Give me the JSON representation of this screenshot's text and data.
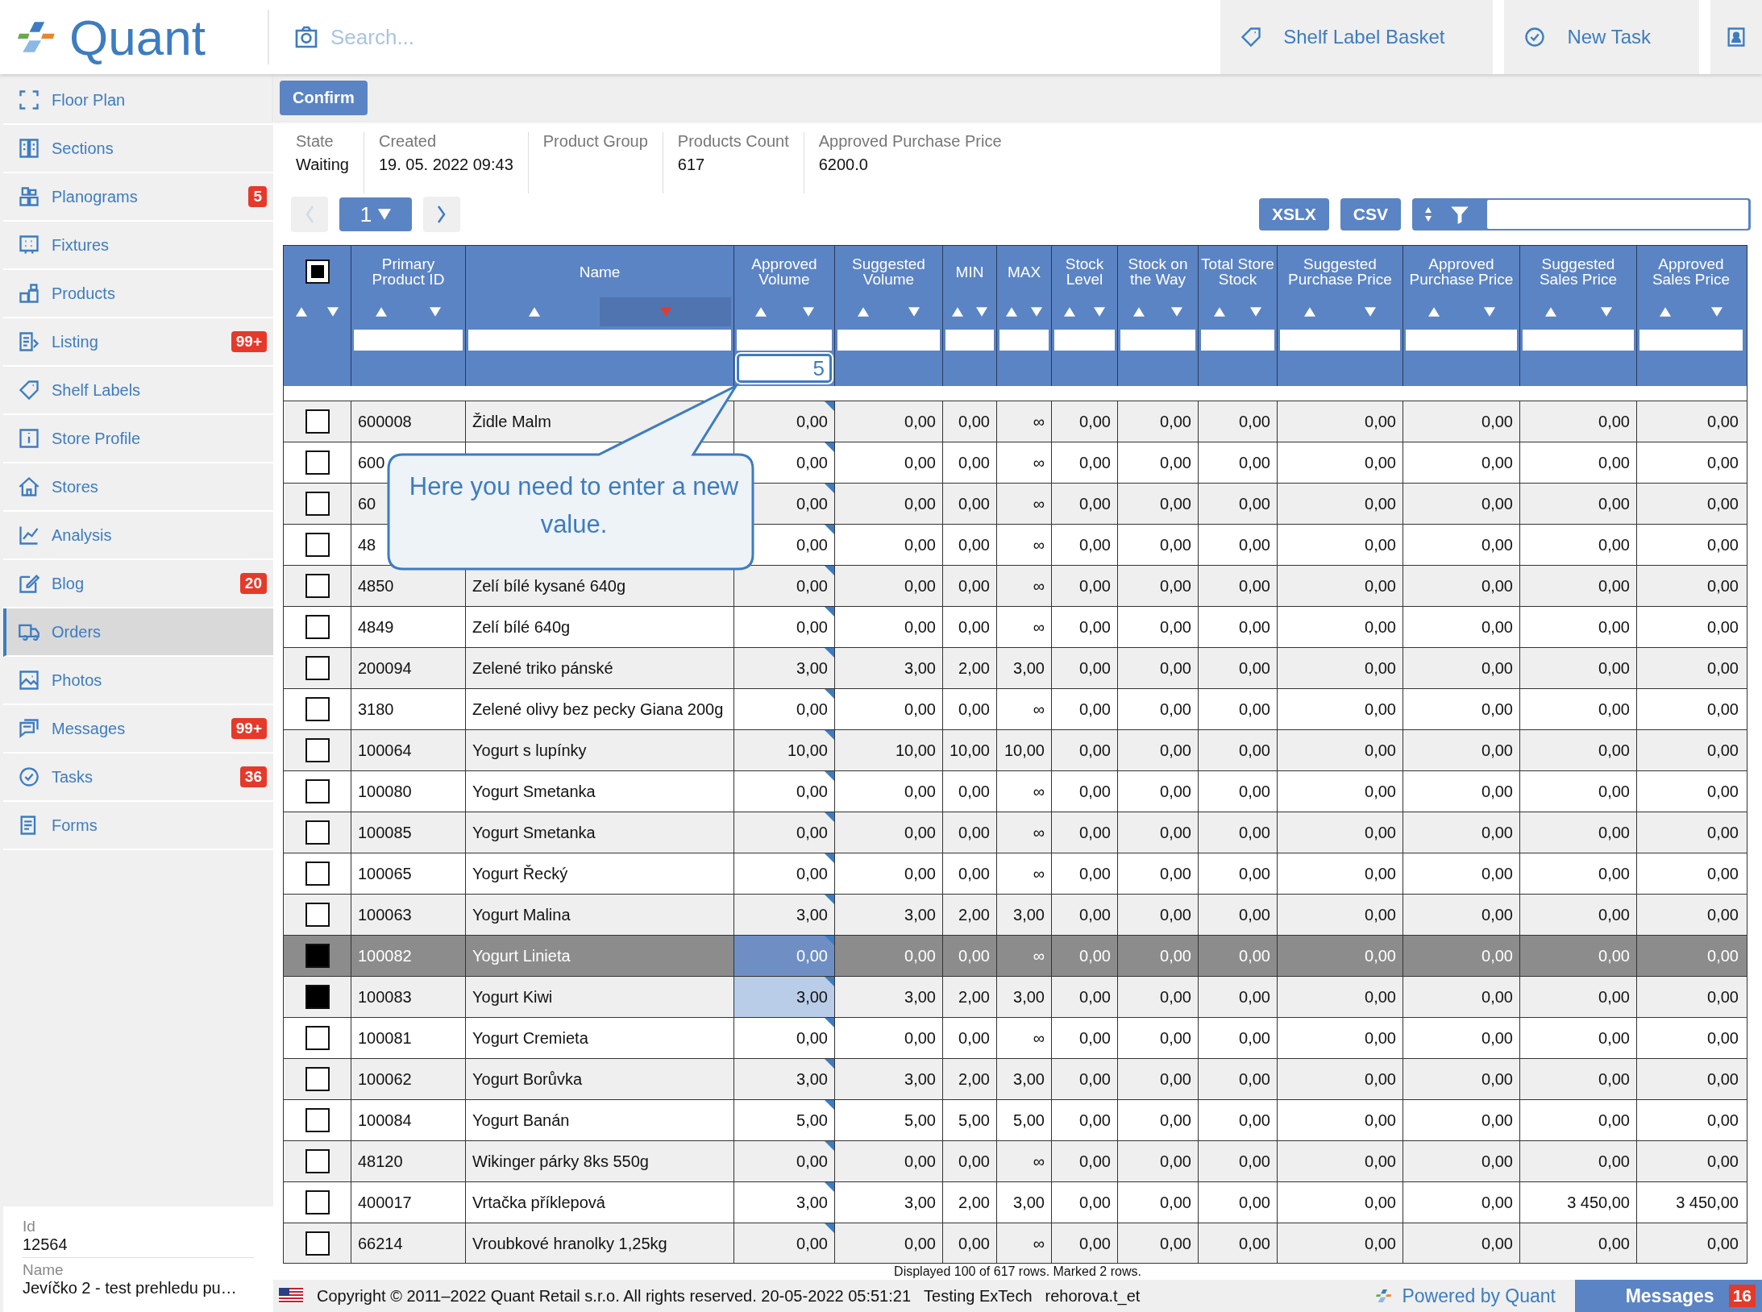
{
  "header": {
    "logo_text": "Quant",
    "search": {
      "placeholder": "Search..."
    },
    "actions": [
      {
        "label": "Shelf Label Basket"
      },
      {
        "label": "New Task"
      }
    ]
  },
  "sidebar": {
    "items": [
      {
        "label": "Floor Plan",
        "selected": false
      },
      {
        "label": "Sections",
        "selected": false
      },
      {
        "label": "Planograms",
        "badge": "5",
        "selected": false
      },
      {
        "label": "Fixtures",
        "selected": false
      },
      {
        "label": "Products",
        "selected": false
      },
      {
        "label": "Listing",
        "badge": "99+",
        "selected": false
      },
      {
        "label": "Shelf Labels",
        "selected": false
      },
      {
        "label": "Store Profile",
        "selected": false
      },
      {
        "label": "Stores",
        "selected": false
      },
      {
        "label": "Analysis",
        "selected": false
      },
      {
        "label": "Blog",
        "badge": "20",
        "selected": false
      },
      {
        "label": "Orders",
        "selected": true
      },
      {
        "label": "Photos",
        "selected": false
      },
      {
        "label": "Messages",
        "badge": "99+",
        "selected": false
      },
      {
        "label": "Tasks",
        "badge": "36",
        "selected": false
      },
      {
        "label": "Forms",
        "selected": false
      }
    ],
    "info": [
      {
        "label": "Id",
        "value": "12564"
      },
      {
        "label": "Name",
        "value": "Jevíčko 2 - test prehledu pu…"
      }
    ]
  },
  "toolbar": {
    "confirm": "Confirm"
  },
  "details": [
    {
      "label": "State",
      "value": "Waiting"
    },
    {
      "label": "Created",
      "value": "19. 05. 2022 09:43"
    },
    {
      "label": "Product Group"
    },
    {
      "label": "Products Count",
      "value": "617"
    },
    {
      "label": "Approved Purchase Price",
      "value": "6200.0"
    }
  ],
  "pager": {
    "page": "1",
    "prev_disabled": true
  },
  "export_buttons": [
    "XSLX",
    "CSV"
  ],
  "table": {
    "select_all_partial": true,
    "edit_value": "5",
    "columns": [
      {
        "label": "Primary Product ID",
        "sorted_desc": false
      },
      {
        "label": "Name",
        "sorted_desc": true
      },
      {
        "label": "Approved Volume",
        "editable": true,
        "sorted_desc": false
      },
      {
        "label": "Suggested Volume",
        "sorted_desc": false
      },
      {
        "label": "MIN",
        "sorted_desc": false
      },
      {
        "label": "MAX",
        "sorted_desc": false
      },
      {
        "label": "Stock Level",
        "sorted_desc": false
      },
      {
        "label": "Stock on the Way",
        "sorted_desc": false
      },
      {
        "label": "Total Store Stock",
        "sorted_desc": false
      },
      {
        "label": "Suggested Purchase Price",
        "sorted_desc": false
      },
      {
        "label": "Approved Purchase Price",
        "sorted_desc": false
      },
      {
        "label": "Suggested Sales Price",
        "sorted_desc": false
      },
      {
        "label": "Approved Sales Price",
        "sorted_desc": false
      }
    ],
    "rows": [
      {
        "checked": false,
        "selected": false,
        "cells": [
          "600008",
          "Židle Malm",
          "0,00",
          "0,00",
          "0,00",
          "∞",
          "0,00",
          "0,00",
          "0,00",
          "0,00",
          "0,00",
          "0,00",
          "0,00"
        ]
      },
      {
        "checked": false,
        "selected": false,
        "cells": [
          "600",
          "",
          "0,00",
          "0,00",
          "0,00",
          "∞",
          "0,00",
          "0,00",
          "0,00",
          "0,00",
          "0,00",
          "0,00",
          "0,00"
        ]
      },
      {
        "checked": false,
        "selected": false,
        "cells": [
          "60",
          "",
          "0,00",
          "0,00",
          "0,00",
          "∞",
          "0,00",
          "0,00",
          "0,00",
          "0,00",
          "0,00",
          "0,00",
          "0,00"
        ]
      },
      {
        "checked": false,
        "selected": false,
        "cells": [
          "48",
          "",
          "0,00",
          "0,00",
          "0,00",
          "∞",
          "0,00",
          "0,00",
          "0,00",
          "0,00",
          "0,00",
          "0,00",
          "0,00"
        ]
      },
      {
        "checked": false,
        "selected": false,
        "cells": [
          "4850",
          "Zelí bílé kysané 640g",
          "0,00",
          "0,00",
          "0,00",
          "∞",
          "0,00",
          "0,00",
          "0,00",
          "0,00",
          "0,00",
          "0,00",
          "0,00"
        ]
      },
      {
        "checked": false,
        "selected": false,
        "cells": [
          "4849",
          "Zelí bílé 640g",
          "0,00",
          "0,00",
          "0,00",
          "∞",
          "0,00",
          "0,00",
          "0,00",
          "0,00",
          "0,00",
          "0,00",
          "0,00"
        ]
      },
      {
        "checked": false,
        "selected": false,
        "cells": [
          "200094",
          "Zelené triko pánské",
          "3,00",
          "3,00",
          "2,00",
          "3,00",
          "0,00",
          "0,00",
          "0,00",
          "0,00",
          "0,00",
          "0,00",
          "0,00"
        ]
      },
      {
        "checked": false,
        "selected": false,
        "cells": [
          "3180",
          "Zelené olivy bez pecky Giana 200g",
          "0,00",
          "0,00",
          "0,00",
          "∞",
          "0,00",
          "0,00",
          "0,00",
          "0,00",
          "0,00",
          "0,00",
          "0,00"
        ]
      },
      {
        "checked": false,
        "selected": false,
        "cells": [
          "100064",
          "Yogurt s lupínky",
          "10,00",
          "10,00",
          "10,00",
          "10,00",
          "0,00",
          "0,00",
          "0,00",
          "0,00",
          "0,00",
          "0,00",
          "0,00"
        ]
      },
      {
        "checked": false,
        "selected": false,
        "cells": [
          "100080",
          "Yogurt Smetanka",
          "0,00",
          "0,00",
          "0,00",
          "∞",
          "0,00",
          "0,00",
          "0,00",
          "0,00",
          "0,00",
          "0,00",
          "0,00"
        ]
      },
      {
        "checked": false,
        "selected": false,
        "cells": [
          "100085",
          "Yogurt Smetanka",
          "0,00",
          "0,00",
          "0,00",
          "∞",
          "0,00",
          "0,00",
          "0,00",
          "0,00",
          "0,00",
          "0,00",
          "0,00"
        ]
      },
      {
        "checked": false,
        "selected": false,
        "cells": [
          "100065",
          "Yogurt Řecký",
          "0,00",
          "0,00",
          "0,00",
          "∞",
          "0,00",
          "0,00",
          "0,00",
          "0,00",
          "0,00",
          "0,00",
          "0,00"
        ]
      },
      {
        "checked": false,
        "selected": false,
        "cells": [
          "100063",
          "Yogurt Malina",
          "3,00",
          "3,00",
          "2,00",
          "3,00",
          "0,00",
          "0,00",
          "0,00",
          "0,00",
          "0,00",
          "0,00",
          "0,00"
        ]
      },
      {
        "checked": true,
        "selected": true,
        "cells": [
          "100082",
          "Yogurt Linieta",
          "0,00",
          "0,00",
          "0,00",
          "∞",
          "0,00",
          "0,00",
          "0,00",
          "0,00",
          "0,00",
          "0,00",
          "0,00"
        ]
      },
      {
        "checked": true,
        "selected": false,
        "cells": [
          "100083",
          "Yogurt Kiwi",
          "3,00",
          "3,00",
          "2,00",
          "3,00",
          "0,00",
          "0,00",
          "0,00",
          "0,00",
          "0,00",
          "0,00",
          "0,00"
        ]
      },
      {
        "checked": false,
        "selected": false,
        "cells": [
          "100081",
          "Yogurt Cremieta",
          "0,00",
          "0,00",
          "0,00",
          "∞",
          "0,00",
          "0,00",
          "0,00",
          "0,00",
          "0,00",
          "0,00",
          "0,00"
        ]
      },
      {
        "checked": false,
        "selected": false,
        "cells": [
          "100062",
          "Yogurt Borůvka",
          "3,00",
          "3,00",
          "2,00",
          "3,00",
          "0,00",
          "0,00",
          "0,00",
          "0,00",
          "0,00",
          "0,00",
          "0,00"
        ]
      },
      {
        "checked": false,
        "selected": false,
        "cells": [
          "100084",
          "Yogurt Banán",
          "5,00",
          "5,00",
          "5,00",
          "5,00",
          "0,00",
          "0,00",
          "0,00",
          "0,00",
          "0,00",
          "0,00",
          "0,00"
        ]
      },
      {
        "checked": false,
        "selected": false,
        "cells": [
          "48120",
          "Wikinger párky 8ks 550g",
          "0,00",
          "0,00",
          "0,00",
          "∞",
          "0,00",
          "0,00",
          "0,00",
          "0,00",
          "0,00",
          "0,00",
          "0,00"
        ]
      },
      {
        "checked": false,
        "selected": false,
        "cells": [
          "400017",
          "Vrtačka příklepová",
          "3,00",
          "3,00",
          "2,00",
          "3,00",
          "0,00",
          "0,00",
          "0,00",
          "0,00",
          "0,00",
          "3 450,00",
          "3 450,00"
        ]
      },
      {
        "checked": false,
        "selected": false,
        "cells": [
          "66214",
          "Vroubkové hranolky 1,25kg",
          "0,00",
          "0,00",
          "0,00",
          "∞",
          "0,00",
          "0,00",
          "0,00",
          "0,00",
          "0,00",
          "0,00",
          "0,00"
        ]
      }
    ],
    "summary": "Displayed 100 of 617 rows. Marked 2 rows."
  },
  "callout": "Here you need to enter a new value.",
  "footer": {
    "copyright": "Copyright © 2011–2022 Quant Retail s.r.o. All rights reserved. 20-05-2022 05:51:21",
    "environment": "Testing ExTech",
    "user": "rehorova.t_et",
    "powered_by": "Powered by Quant",
    "messages": {
      "label": "Messages",
      "badge": "16"
    }
  }
}
